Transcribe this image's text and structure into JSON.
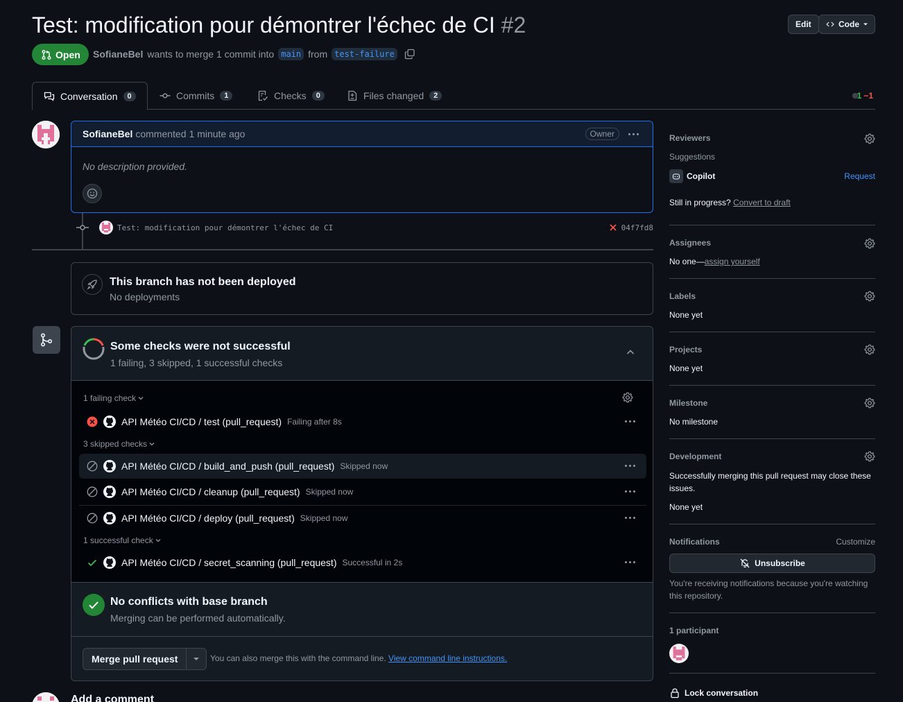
{
  "pr": {
    "title": "Test: modification pour démontrer l'échec de CI",
    "number": "#2",
    "state": "Open",
    "author": "SofianeBel",
    "merge_text_1": "wants to merge 1 commit into",
    "base_branch": "main",
    "merge_text_2": "from",
    "head_branch": "test-failure"
  },
  "header_buttons": {
    "edit": "Edit",
    "code": "Code"
  },
  "tabs": [
    {
      "label": "Conversation",
      "count": "0"
    },
    {
      "label": "Commits",
      "count": "1"
    },
    {
      "label": "Checks",
      "count": "0"
    },
    {
      "label": "Files changed",
      "count": "2"
    }
  ],
  "diffstat": {
    "added": "+1",
    "removed": "−1"
  },
  "comment": {
    "author": "SofianeBel",
    "action": "commented",
    "time": "1 minute ago",
    "badge": "Owner",
    "body": "No description provided."
  },
  "commit": {
    "message": "Test: modification pour démontrer l'échec de CI",
    "sha": "04f7fd8"
  },
  "deploy": {
    "title": "This branch has not been deployed",
    "subtitle": "No deployments"
  },
  "checks": {
    "title": "Some checks were not successful",
    "summary": "1 failing, 3 skipped, 1 successful checks",
    "failing_label": "1 failing check",
    "skipped_label": "3 skipped checks",
    "successful_label": "1 successful check",
    "failing": [
      {
        "name": "API Météo CI/CD / test (pull_request)",
        "status": "Failing after 8s"
      }
    ],
    "skipped": [
      {
        "name": "API Météo CI/CD / build_and_push (pull_request)",
        "status": "Skipped now"
      },
      {
        "name": "API Météo CI/CD / cleanup (pull_request)",
        "status": "Skipped now"
      },
      {
        "name": "API Météo CI/CD / deploy (pull_request)",
        "status": "Skipped now"
      }
    ],
    "successful": [
      {
        "name": "API Météo CI/CD / secret_scanning (pull_request)",
        "status": "Successful in 2s"
      }
    ]
  },
  "conflicts": {
    "title": "No conflicts with base branch",
    "subtitle": "Merging can be performed automatically."
  },
  "merge": {
    "button": "Merge pull request",
    "hint": "You can also merge this with the command line.",
    "hint_link": "View command line instructions."
  },
  "add_comment": "Add a comment",
  "sidebar": {
    "reviewers": {
      "title": "Reviewers",
      "suggestions": "Suggestions",
      "suggested": "Copilot",
      "request": "Request",
      "still_in_progress": "Still in progress?",
      "convert_to_draft": "Convert to draft"
    },
    "assignees": {
      "title": "Assignees",
      "none": "No one—",
      "assign_link": "assign yourself"
    },
    "labels": {
      "title": "Labels",
      "value": "None yet"
    },
    "projects": {
      "title": "Projects",
      "value": "None yet"
    },
    "milestone": {
      "title": "Milestone",
      "value": "No milestone"
    },
    "development": {
      "title": "Development",
      "text": "Successfully merging this pull request may close these issues.",
      "value": "None yet"
    },
    "notifications": {
      "title": "Notifications",
      "customize": "Customize",
      "button": "Unsubscribe",
      "reason": "You're receiving notifications because you're watching this repository."
    },
    "participants": {
      "title": "1 participant"
    },
    "lock": "Lock conversation"
  },
  "colors": {
    "accent_blue": "#4493f8",
    "open_green": "#238636",
    "fail_red": "#f85149",
    "success_green": "#3fb950",
    "avatar_pink": "#e0719a"
  }
}
